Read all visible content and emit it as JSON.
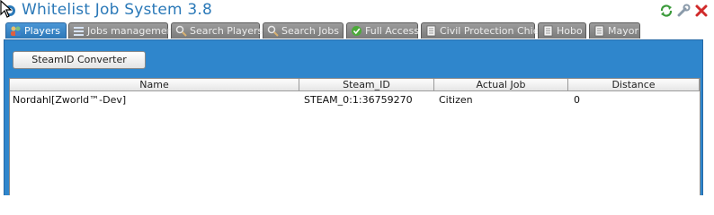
{
  "window": {
    "title": "Whitelist Job System 3.8",
    "accent": "#2b79b8",
    "buttons": [
      {
        "name": "refresh-icon"
      },
      {
        "name": "wrench-icon"
      },
      {
        "name": "close-icon"
      }
    ]
  },
  "tabs": [
    {
      "label": "Players",
      "icon": "players-icon",
      "active": true
    },
    {
      "label": "Jobs management",
      "icon": "list-icon",
      "active": false
    },
    {
      "label": "Search Players",
      "icon": "search-icon",
      "active": false
    },
    {
      "label": "Search Jobs",
      "icon": "search-icon",
      "active": false
    },
    {
      "label": "Full Access",
      "icon": "check-icon",
      "active": false
    },
    {
      "label": "Civil Protection Chief",
      "icon": "document-icon",
      "active": false
    },
    {
      "label": "Hobo",
      "icon": "document-icon",
      "active": false
    },
    {
      "label": "Mayor",
      "icon": "document-icon",
      "active": false
    }
  ],
  "panel": {
    "background": "#2f86cc",
    "converter_button": "SteamID Converter"
  },
  "table": {
    "columns": [
      "Name",
      "Steam_ID",
      "Actual Job",
      "Distance"
    ],
    "rows": [
      {
        "name": "Nordahl[Zworld™-Dev]",
        "steam_id": "STEAM_0:1:36759270",
        "job": "Citizen",
        "distance": "0"
      }
    ]
  }
}
